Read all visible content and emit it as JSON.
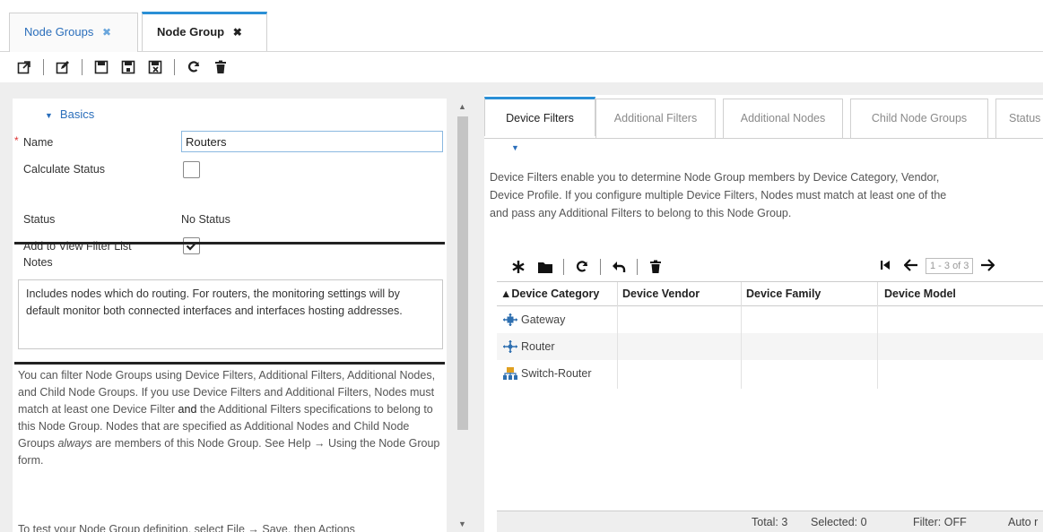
{
  "top_tabs": [
    {
      "label": "Node Groups",
      "close": "✖"
    },
    {
      "label": "Node Group",
      "close": "✖"
    }
  ],
  "toolbar_icons": [
    "open-external-icon",
    "edit-icon",
    "save-icon",
    "save-as-icon",
    "save-close-icon",
    "refresh-icon",
    "delete-icon"
  ],
  "basics": {
    "header": "Basics",
    "name_label": "Name",
    "name_required_marker": "*",
    "name_value": "Routers",
    "calculate_status_label": "Calculate Status",
    "calculate_status_checked": false,
    "status_label": "Status",
    "status_value": "No Status",
    "add_to_view_filter_label": "Add to View Filter List",
    "add_to_view_filter_checked": true
  },
  "notes": {
    "label": "Notes",
    "text": "Includes nodes which do routing. For routers, the monitoring settings will by default monitor both connected interfaces and interfaces hosting addresses."
  },
  "help": {
    "p1_a": "You can filter Node Groups using Device Filters, Additional Filters, Additional Nodes, and Child Node Groups. If you use Device Filters and Additional Filters, Nodes must match at least one Device Filter ",
    "p1_and": "and",
    "p1_b": " the Additional Filters specifications to belong to this Node Group. Nodes that are specified as Additional Nodes and Child Node Groups ",
    "p1_always": "always",
    "p1_c": " are members of this Node Group. See Help → Using the Node Group form.",
    "p2": "To test your Node Group definition, select File → Save, then Actions"
  },
  "right_tabs": [
    "Device Filters",
    "Additional Filters",
    "Additional Nodes",
    "Child Node Groups",
    "Status"
  ],
  "right_desc": [
    "Device Filters enable you to determine Node Group members by Device Category, Vendor,",
    "Device Profile. If you configure multiple Device Filters, Nodes must match at least one of the",
    "and pass any Additional Filters to belong to this Node Group."
  ],
  "pager": {
    "range": "1 - 3 of 3"
  },
  "grid": {
    "headers": [
      "▲Device Category",
      "Device Vendor",
      "Device Family",
      "Device Model"
    ],
    "rows": [
      {
        "category": "Gateway",
        "icon": "gateway-icon"
      },
      {
        "category": "Router",
        "icon": "router-icon"
      },
      {
        "category": "Switch-Router",
        "icon": "switch-router-icon"
      }
    ],
    "footer": {
      "total": "Total: 3",
      "selected": "Selected: 0",
      "filter": "Filter: OFF",
      "auto": "Auto r"
    }
  }
}
